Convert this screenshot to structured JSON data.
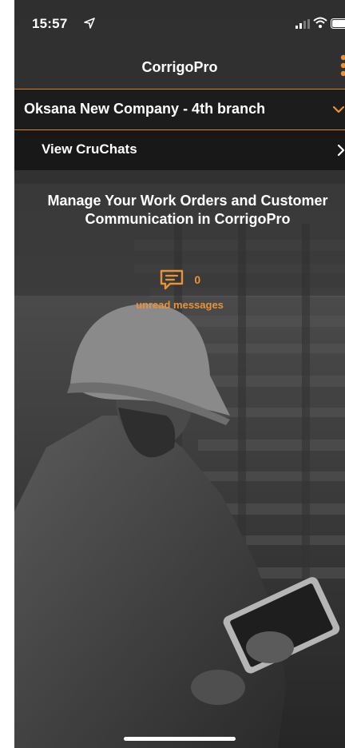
{
  "status_bar": {
    "time": "15:57"
  },
  "app_bar": {
    "title": "CorrigoPro"
  },
  "company_selector": {
    "label": "Oksana New Company - 4th branch"
  },
  "cruchats_link": {
    "label": "View CruChats"
  },
  "main": {
    "headline": "Manage Your Work Orders and Customer Communication in CorrigoPro",
    "unread_count": "0",
    "unread_label": "unread messages"
  },
  "colors": {
    "accent": "#e8923a",
    "background": "#2c2c2c",
    "text": "#ffffff"
  },
  "icons": {
    "location": "location-arrow-icon",
    "signal": "signal-icon",
    "wifi": "wifi-icon",
    "battery": "battery-icon",
    "menu": "kebab-menu-icon",
    "dropdown": "chevron-down-icon",
    "forward": "chevron-right-icon",
    "messages": "chat-bubble-icon"
  }
}
